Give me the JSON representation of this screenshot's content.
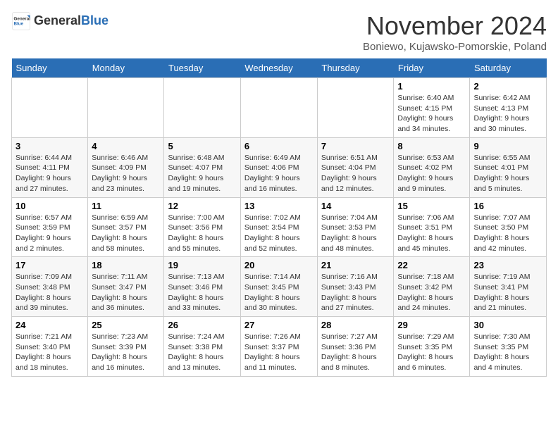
{
  "logo": {
    "general": "General",
    "blue": "Blue"
  },
  "title": "November 2024",
  "location": "Boniewo, Kujawsko-Pomorskie, Poland",
  "days_of_week": [
    "Sunday",
    "Monday",
    "Tuesday",
    "Wednesday",
    "Thursday",
    "Friday",
    "Saturday"
  ],
  "weeks": [
    [
      {
        "day": "",
        "info": ""
      },
      {
        "day": "",
        "info": ""
      },
      {
        "day": "",
        "info": ""
      },
      {
        "day": "",
        "info": ""
      },
      {
        "day": "",
        "info": ""
      },
      {
        "day": "1",
        "info": "Sunrise: 6:40 AM\nSunset: 4:15 PM\nDaylight: 9 hours and 34 minutes."
      },
      {
        "day": "2",
        "info": "Sunrise: 6:42 AM\nSunset: 4:13 PM\nDaylight: 9 hours and 30 minutes."
      }
    ],
    [
      {
        "day": "3",
        "info": "Sunrise: 6:44 AM\nSunset: 4:11 PM\nDaylight: 9 hours and 27 minutes."
      },
      {
        "day": "4",
        "info": "Sunrise: 6:46 AM\nSunset: 4:09 PM\nDaylight: 9 hours and 23 minutes."
      },
      {
        "day": "5",
        "info": "Sunrise: 6:48 AM\nSunset: 4:07 PM\nDaylight: 9 hours and 19 minutes."
      },
      {
        "day": "6",
        "info": "Sunrise: 6:49 AM\nSunset: 4:06 PM\nDaylight: 9 hours and 16 minutes."
      },
      {
        "day": "7",
        "info": "Sunrise: 6:51 AM\nSunset: 4:04 PM\nDaylight: 9 hours and 12 minutes."
      },
      {
        "day": "8",
        "info": "Sunrise: 6:53 AM\nSunset: 4:02 PM\nDaylight: 9 hours and 9 minutes."
      },
      {
        "day": "9",
        "info": "Sunrise: 6:55 AM\nSunset: 4:01 PM\nDaylight: 9 hours and 5 minutes."
      }
    ],
    [
      {
        "day": "10",
        "info": "Sunrise: 6:57 AM\nSunset: 3:59 PM\nDaylight: 9 hours and 2 minutes."
      },
      {
        "day": "11",
        "info": "Sunrise: 6:59 AM\nSunset: 3:57 PM\nDaylight: 8 hours and 58 minutes."
      },
      {
        "day": "12",
        "info": "Sunrise: 7:00 AM\nSunset: 3:56 PM\nDaylight: 8 hours and 55 minutes."
      },
      {
        "day": "13",
        "info": "Sunrise: 7:02 AM\nSunset: 3:54 PM\nDaylight: 8 hours and 52 minutes."
      },
      {
        "day": "14",
        "info": "Sunrise: 7:04 AM\nSunset: 3:53 PM\nDaylight: 8 hours and 48 minutes."
      },
      {
        "day": "15",
        "info": "Sunrise: 7:06 AM\nSunset: 3:51 PM\nDaylight: 8 hours and 45 minutes."
      },
      {
        "day": "16",
        "info": "Sunrise: 7:07 AM\nSunset: 3:50 PM\nDaylight: 8 hours and 42 minutes."
      }
    ],
    [
      {
        "day": "17",
        "info": "Sunrise: 7:09 AM\nSunset: 3:48 PM\nDaylight: 8 hours and 39 minutes."
      },
      {
        "day": "18",
        "info": "Sunrise: 7:11 AM\nSunset: 3:47 PM\nDaylight: 8 hours and 36 minutes."
      },
      {
        "day": "19",
        "info": "Sunrise: 7:13 AM\nSunset: 3:46 PM\nDaylight: 8 hours and 33 minutes."
      },
      {
        "day": "20",
        "info": "Sunrise: 7:14 AM\nSunset: 3:45 PM\nDaylight: 8 hours and 30 minutes."
      },
      {
        "day": "21",
        "info": "Sunrise: 7:16 AM\nSunset: 3:43 PM\nDaylight: 8 hours and 27 minutes."
      },
      {
        "day": "22",
        "info": "Sunrise: 7:18 AM\nSunset: 3:42 PM\nDaylight: 8 hours and 24 minutes."
      },
      {
        "day": "23",
        "info": "Sunrise: 7:19 AM\nSunset: 3:41 PM\nDaylight: 8 hours and 21 minutes."
      }
    ],
    [
      {
        "day": "24",
        "info": "Sunrise: 7:21 AM\nSunset: 3:40 PM\nDaylight: 8 hours and 18 minutes."
      },
      {
        "day": "25",
        "info": "Sunrise: 7:23 AM\nSunset: 3:39 PM\nDaylight: 8 hours and 16 minutes."
      },
      {
        "day": "26",
        "info": "Sunrise: 7:24 AM\nSunset: 3:38 PM\nDaylight: 8 hours and 13 minutes."
      },
      {
        "day": "27",
        "info": "Sunrise: 7:26 AM\nSunset: 3:37 PM\nDaylight: 8 hours and 11 minutes."
      },
      {
        "day": "28",
        "info": "Sunrise: 7:27 AM\nSunset: 3:36 PM\nDaylight: 8 hours and 8 minutes."
      },
      {
        "day": "29",
        "info": "Sunrise: 7:29 AM\nSunset: 3:35 PM\nDaylight: 8 hours and 6 minutes."
      },
      {
        "day": "30",
        "info": "Sunrise: 7:30 AM\nSunset: 3:35 PM\nDaylight: 8 hours and 4 minutes."
      }
    ]
  ]
}
